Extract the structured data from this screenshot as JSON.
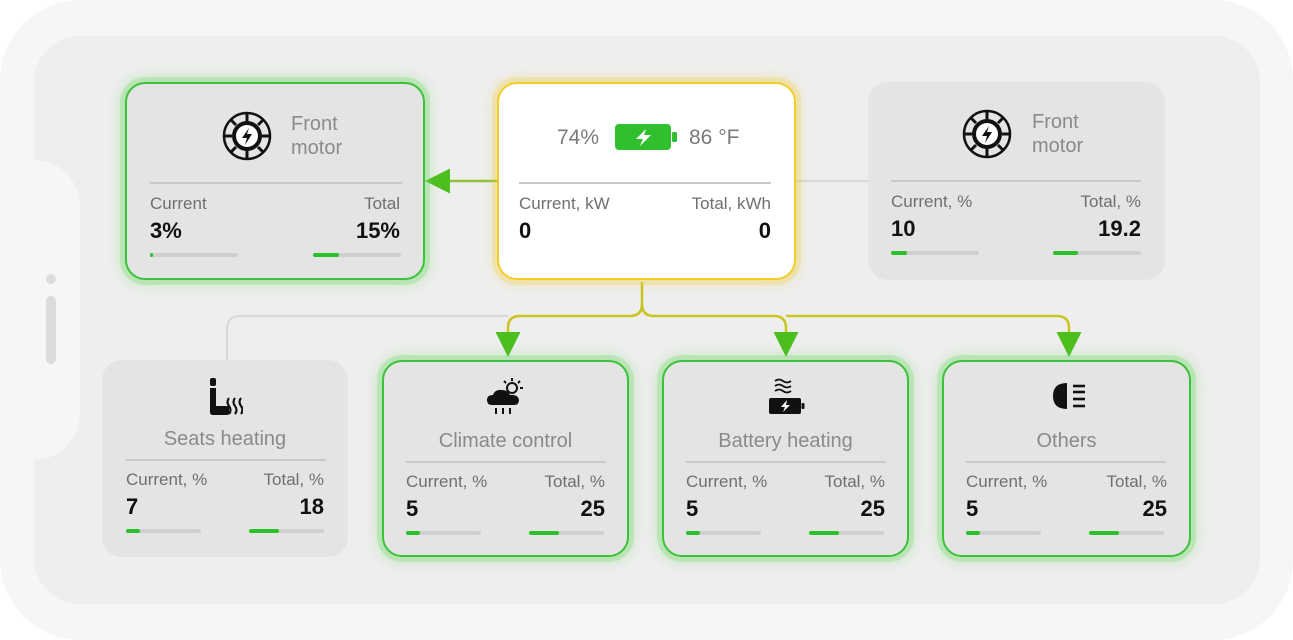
{
  "colors": {
    "accent_green": "#3cc23a",
    "hub_yellow": "#f2cd2a",
    "bar_green": "#2bbf2b"
  },
  "hub": {
    "battery_percent": "74%",
    "temperature": "86 °F",
    "current_label": "Current, kW",
    "total_label": "Total, kWh",
    "current_value": "0",
    "total_value": "0",
    "icon": "battery-charging-icon"
  },
  "front_motor_left": {
    "title_line1": "Front",
    "title_line2": "motor",
    "icon": "motor-icon",
    "current_label": "Current",
    "total_label": "Total",
    "current_value": "3%",
    "total_value": "15%",
    "current_fraction": 0.03,
    "total_fraction": 0.3,
    "active": true
  },
  "front_motor_right": {
    "title_line1": "Front",
    "title_line2": "motor",
    "icon": "motor-icon",
    "current_label": "Current, %",
    "total_label": "Total, %",
    "current_value": "10",
    "total_value": "19.2",
    "current_fraction": 0.18,
    "total_fraction": 0.28,
    "active": false
  },
  "seats_heating": {
    "title": "Seats heating",
    "icon": "seat-heating-icon",
    "current_label": "Current, %",
    "total_label": "Total, %",
    "current_value": "7",
    "total_value": "18",
    "current_fraction": 0.18,
    "total_fraction": 0.4,
    "active": false
  },
  "climate_control": {
    "title": "Climate control",
    "icon": "climate-icon",
    "current_label": "Current, %",
    "total_label": "Total, %",
    "current_value": "5",
    "total_value": "25",
    "current_fraction": 0.18,
    "total_fraction": 0.4,
    "active": true
  },
  "battery_heating": {
    "title": "Battery heating",
    "icon": "battery-heating-icon",
    "current_label": "Current, %",
    "total_label": "Total, %",
    "current_value": "5",
    "total_value": "25",
    "current_fraction": 0.18,
    "total_fraction": 0.4,
    "active": true
  },
  "others": {
    "title": "Others",
    "icon": "headlight-icon",
    "current_label": "Current, %",
    "total_label": "Total, %",
    "current_value": "5",
    "total_value": "25",
    "current_fraction": 0.18,
    "total_fraction": 0.4,
    "active": true
  }
}
